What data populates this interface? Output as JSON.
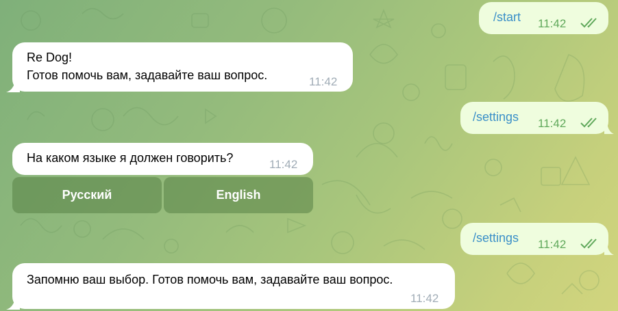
{
  "chat": {
    "messages": [
      {
        "id": "m1",
        "direction": "outgoing",
        "text": "/start",
        "time": "11:42",
        "status": "read"
      },
      {
        "id": "m2",
        "direction": "incoming",
        "line1": "Re Dog!",
        "line2": "Готов помочь вам, задавайте ваш вопрос.",
        "time": "11:42"
      },
      {
        "id": "m3",
        "direction": "outgoing",
        "text": "/settings",
        "time": "11:42",
        "status": "read"
      },
      {
        "id": "m4",
        "direction": "incoming",
        "text": "На каком языке я должен говорить?",
        "time": "11:42",
        "keyboard": [
          {
            "label": "Русский"
          },
          {
            "label": "English"
          }
        ]
      },
      {
        "id": "m5",
        "direction": "outgoing",
        "text": "/settings",
        "time": "11:42",
        "status": "read"
      },
      {
        "id": "m6",
        "direction": "incoming",
        "text": "Запомню ваш выбор. Готов помочь вам, задавайте ваш вопрос.",
        "time": "11:42"
      }
    ]
  },
  "colors": {
    "background_start": "#7fb07a",
    "background_end": "#d2d57e",
    "incoming_bubble": "#ffffff",
    "outgoing_bubble": "#effdde",
    "command_link": "#3a8fc8",
    "read_check": "#5fa85a",
    "keyboard_button": "#58824699"
  },
  "icons": {
    "read_status": "double-check-icon"
  }
}
